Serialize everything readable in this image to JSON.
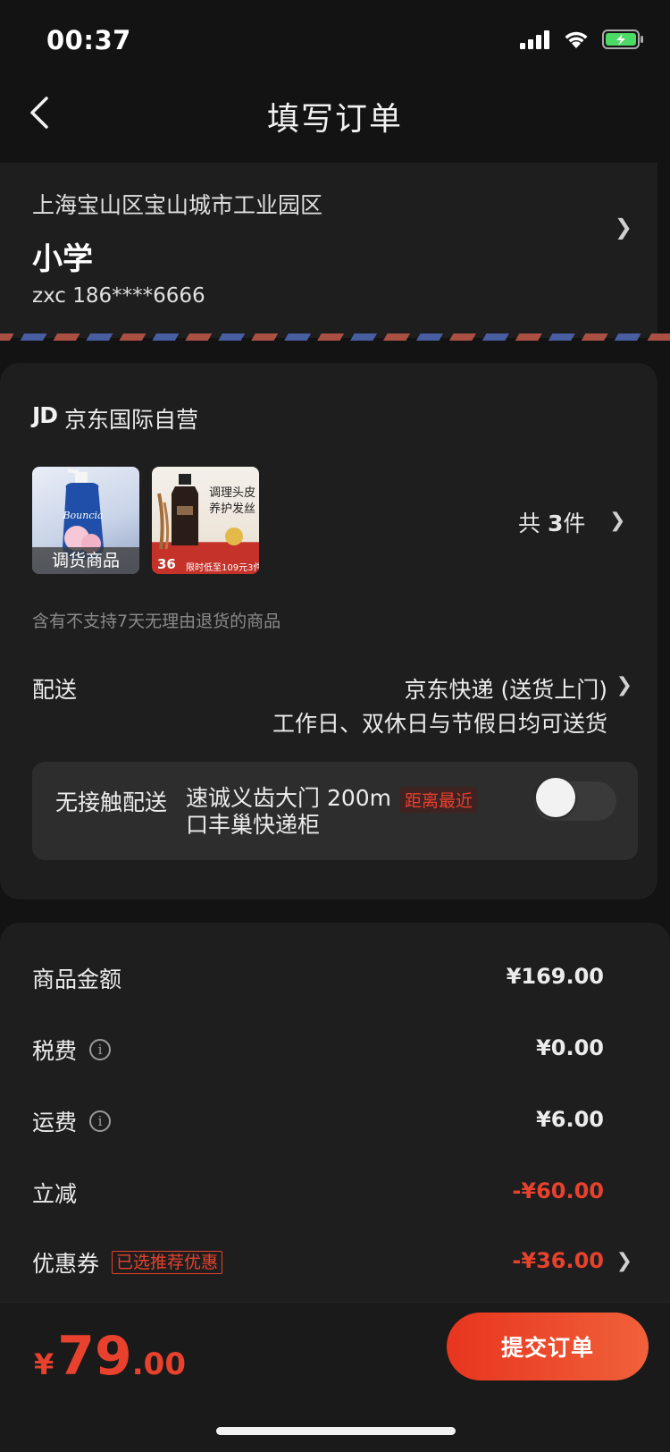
{
  "status_bar": {
    "time": "00:37"
  },
  "nav": {
    "title": "填写订单"
  },
  "address": {
    "region": "上海宝山区宝山城市工业园区",
    "detail": "小学",
    "contact": "zxc  186****6666"
  },
  "store": {
    "logo": "JD",
    "name": "京东国际自营"
  },
  "products": [
    {
      "tag": "调货商品",
      "image": "shower-gel-bottle"
    },
    {
      "image": "hair-care-shampoo",
      "text_line1": "调理头皮",
      "text_line2": "养护发丝",
      "price_tag": "36",
      "banner": "限时低至109元3件"
    }
  ],
  "item_count": {
    "prefix": "共",
    "number": "3",
    "suffix": "件"
  },
  "return_note": "含有不支持7天无理由退货的商品",
  "delivery": {
    "label": "配送",
    "method": "京东快递 (送货上门)",
    "time": "工作日、双休日与节假日均可送货"
  },
  "contactless": {
    "label": "无接触配送",
    "locker_line1": "速诚义齿大门 200m",
    "locker_line2": "口丰巢快递柜",
    "badge": "距离最近",
    "enabled": false
  },
  "price_rows": {
    "goods": {
      "label": "商品金额",
      "value": "¥169.00"
    },
    "tax": {
      "label": "税费",
      "value": "¥0.00"
    },
    "shipping": {
      "label": "运费",
      "value": "¥6.00"
    },
    "discount": {
      "label": "立减",
      "value": "-¥60.00"
    },
    "coupon": {
      "label": "优惠券",
      "tag": "已选推荐优惠",
      "value": "-¥36.00"
    }
  },
  "total": {
    "currency": "¥",
    "integer": "79",
    "decimal": ".00"
  },
  "submit_label": "提交订单",
  "colors": {
    "accent": "#e8412d",
    "background": "#131313",
    "card": "#1e1e1e"
  }
}
